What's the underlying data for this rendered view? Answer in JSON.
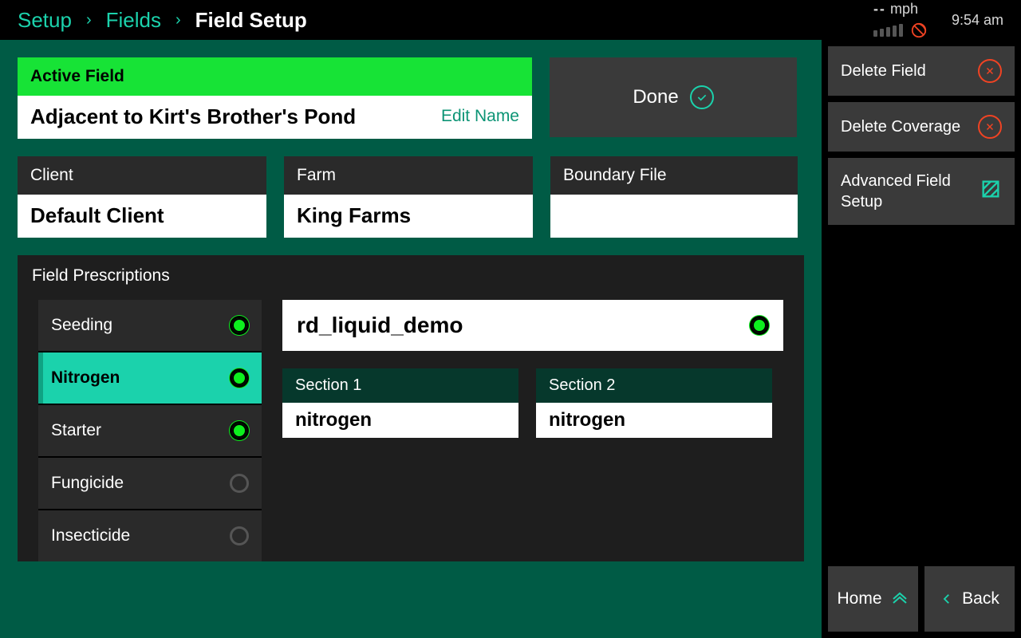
{
  "breadcrumb": {
    "lvl1": "Setup",
    "lvl2": "Fields",
    "current": "Field Setup"
  },
  "status": {
    "speed_value": "--",
    "speed_unit": "mph",
    "time": "9:54 am"
  },
  "active_field": {
    "header": "Active Field",
    "name": "Adjacent to Kirt's Brother's Pond",
    "edit": "Edit Name"
  },
  "done": "Done",
  "client": {
    "label": "Client",
    "value": "Default Client"
  },
  "farm": {
    "label": "Farm",
    "value": "King Farms"
  },
  "boundary": {
    "label": "Boundary File",
    "value": ""
  },
  "rx": {
    "title": "Field Prescriptions",
    "items": {
      "0": {
        "label": "Seeding"
      },
      "1": {
        "label": "Nitrogen"
      },
      "2": {
        "label": "Starter"
      },
      "3": {
        "label": "Fungicide"
      },
      "4": {
        "label": "Insecticide"
      }
    },
    "file": "rd_liquid_demo",
    "section1": {
      "label": "Section 1",
      "value": "nitrogen"
    },
    "section2": {
      "label": "Section 2",
      "value": "nitrogen"
    }
  },
  "side": {
    "delete_field": "Delete Field",
    "delete_coverage": "Delete Coverage",
    "advanced": "Advanced Field Setup",
    "home": "Home",
    "back": "Back"
  }
}
